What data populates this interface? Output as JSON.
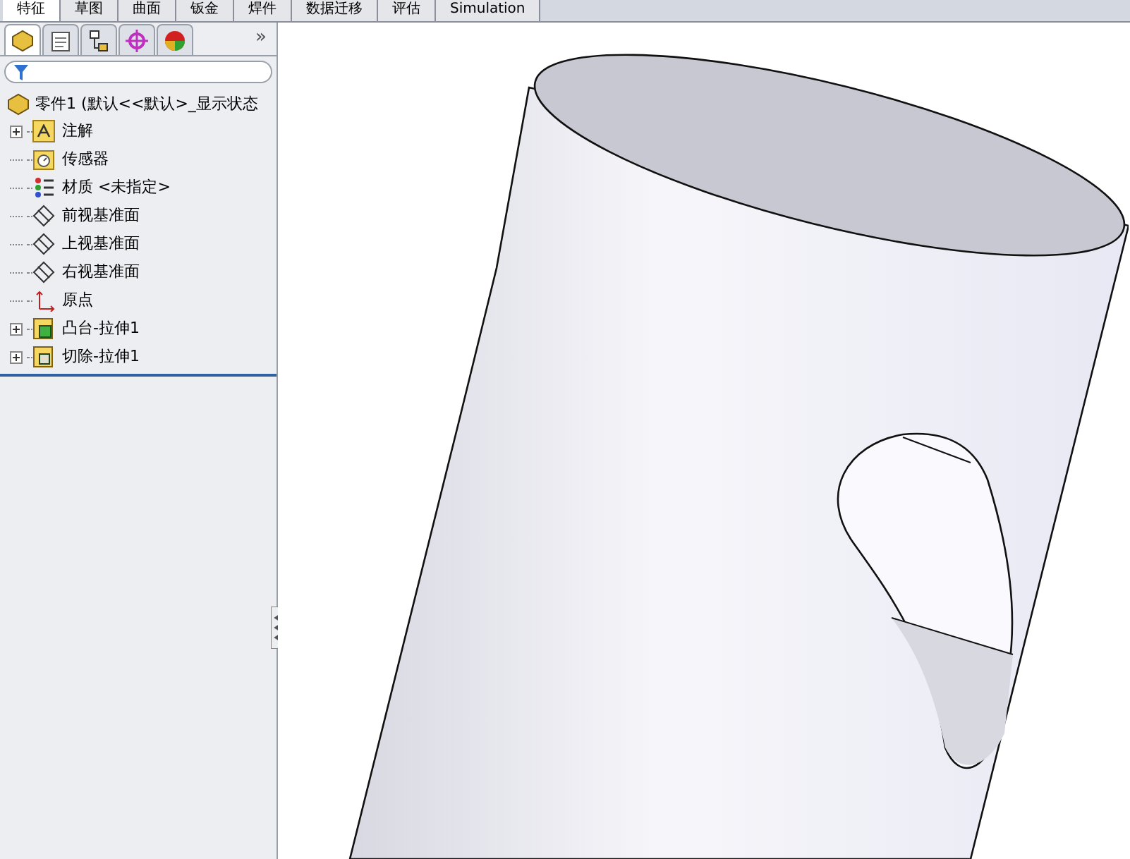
{
  "command_tabs": [
    {
      "label": "特征",
      "selected": true
    },
    {
      "label": "草图",
      "selected": false
    },
    {
      "label": "曲面",
      "selected": false
    },
    {
      "label": "钣金",
      "selected": false
    },
    {
      "label": "焊件",
      "selected": false
    },
    {
      "label": "数据迁移",
      "selected": false
    },
    {
      "label": "评估",
      "selected": false
    },
    {
      "label": "Simulation",
      "selected": false
    }
  ],
  "panel_tabs": [
    {
      "kind": "feature",
      "selected": true
    },
    {
      "kind": "property",
      "selected": false
    },
    {
      "kind": "config",
      "selected": false
    },
    {
      "kind": "target",
      "selected": false
    },
    {
      "kind": "appearance",
      "selected": false
    }
  ],
  "panel_more": "»",
  "tree": {
    "root": "零件1  (默认<<默认>_显示状态",
    "items": [
      {
        "kind": "annotation",
        "label": "注解",
        "expandable": true
      },
      {
        "kind": "sensor",
        "label": "传感器",
        "expandable": false
      },
      {
        "kind": "material",
        "label": "材质 <未指定>",
        "expandable": false
      },
      {
        "kind": "plane",
        "label": "前视基准面",
        "expandable": false
      },
      {
        "kind": "plane",
        "label": "上视基准面",
        "expandable": false
      },
      {
        "kind": "plane",
        "label": "右视基准面",
        "expandable": false
      },
      {
        "kind": "origin",
        "label": "原点",
        "expandable": false
      },
      {
        "kind": "boss",
        "label": "凸台-拉伸1",
        "expandable": true
      },
      {
        "kind": "cut",
        "label": "切除-拉伸1",
        "expandable": true
      }
    ]
  }
}
